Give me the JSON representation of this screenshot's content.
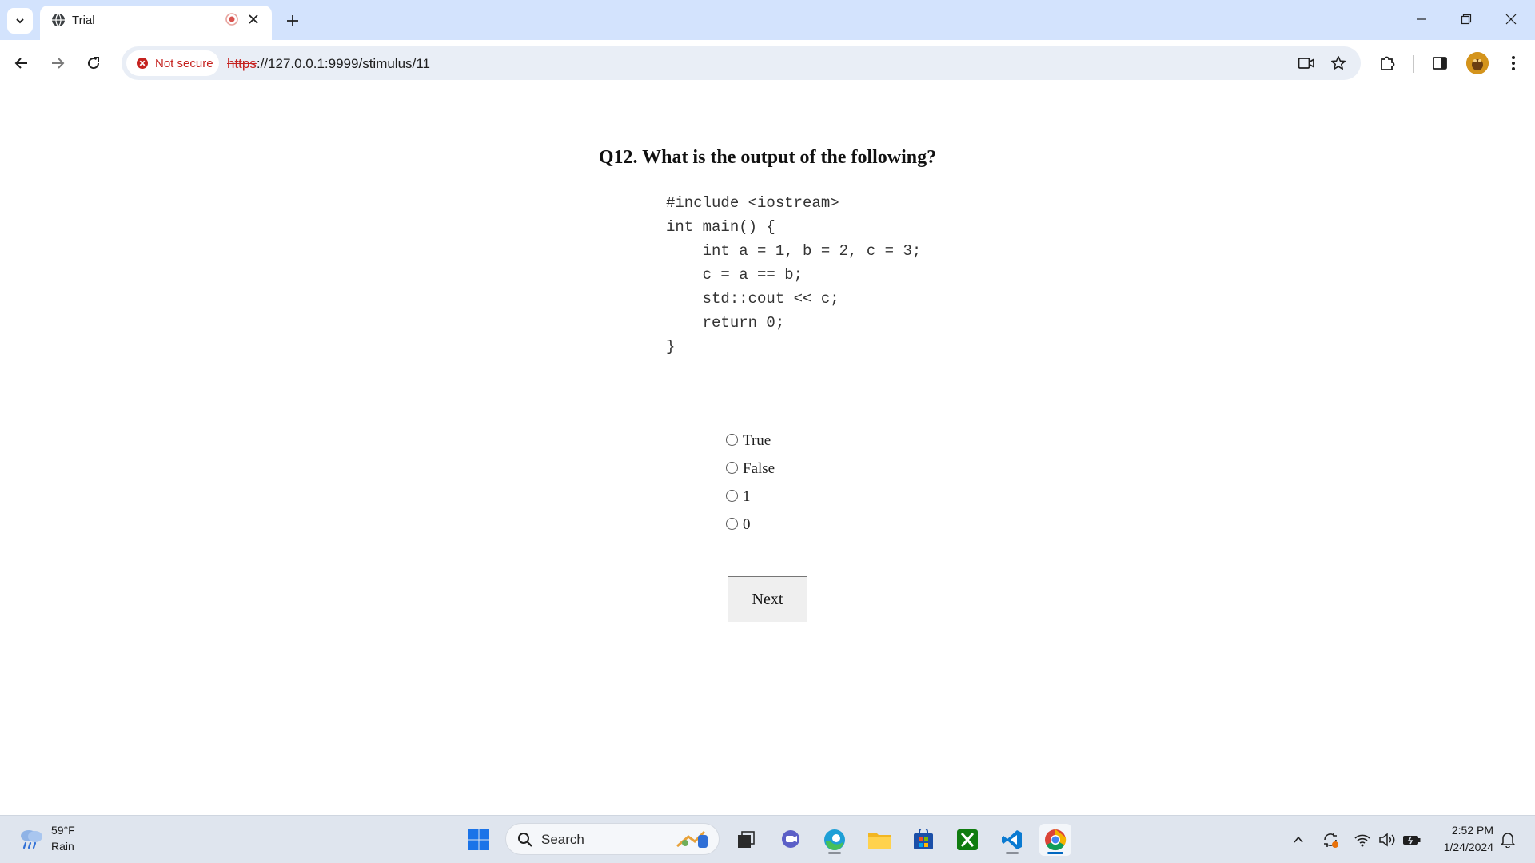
{
  "browser": {
    "tab": {
      "title": "Trial"
    },
    "security_chip": "Not secure",
    "url": {
      "scheme": "https",
      "rest": "://127.0.0.1:9999/stimulus/11"
    }
  },
  "page": {
    "question": "Q12. What is the output of the following?",
    "code": "#include <iostream>\nint main() {\n    int a = 1, b = 2, c = 3;\n    c = a == b;\n    std::cout << c;\n    return 0;\n}",
    "options": [
      {
        "label": "True"
      },
      {
        "label": "False"
      },
      {
        "label": "1"
      },
      {
        "label": "0"
      }
    ],
    "next_label": "Next"
  },
  "taskbar": {
    "weather": {
      "temp": "59°F",
      "condition": "Rain"
    },
    "search_placeholder": "Search",
    "clock": {
      "time": "2:52 PM",
      "date": "1/24/2024"
    }
  },
  "colors": {
    "tabstrip": "#d3e3fd",
    "omnibox": "#e9eef6",
    "insecure_red": "#c5221f",
    "taskbar": "#dfe5ee"
  }
}
